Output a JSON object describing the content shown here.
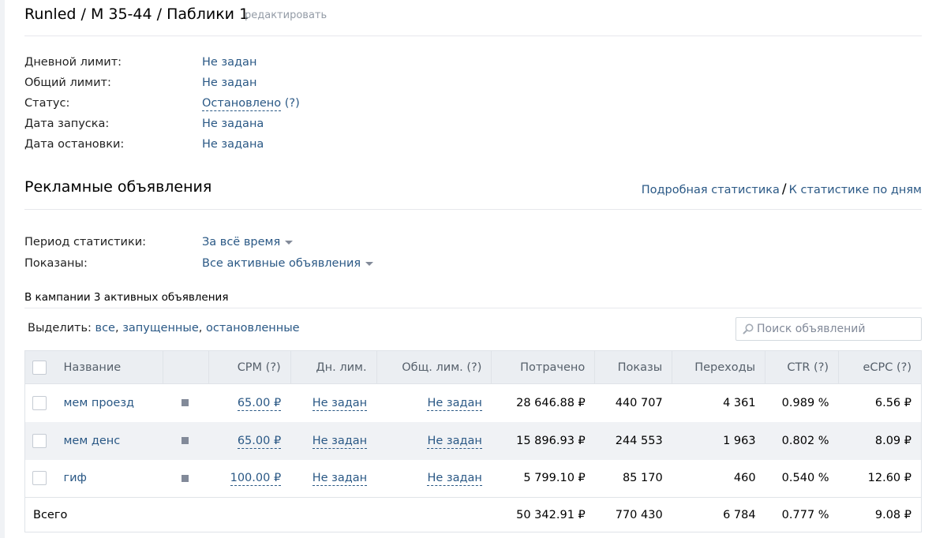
{
  "header": {
    "title": "Runled / М 35-44 / Паблики 1",
    "edit_link": "редактировать"
  },
  "campaign_info": [
    {
      "label": "Дневной лимит:",
      "value": "Не задан"
    },
    {
      "label": "Общий лимит:",
      "value": "Не задан"
    },
    {
      "label": "Статус:",
      "value": "Остановлено",
      "help": "(?)"
    },
    {
      "label": "Дата запуска:",
      "value": "Не задана"
    },
    {
      "label": "Дата остановки:",
      "value": "Не задана"
    }
  ],
  "ads_section": {
    "title": "Рекламные объявления",
    "detailed_stats_link": "Подробная статистика",
    "separator": "/",
    "daily_stats_link": "К статистике по дням"
  },
  "filters": {
    "period_label": "Период статистики:",
    "period_value": "За всё время",
    "shown_label": "Показаны:",
    "shown_value": "Все активные объявления"
  },
  "count_text": "В кампании 3 активных объявления",
  "select_bar": {
    "label": "Выделить:",
    "all": "все",
    "running": "запущенные",
    "stopped": "остановленные",
    "comma": ","
  },
  "search": {
    "placeholder": "Поиск объявлений"
  },
  "table": {
    "headers": {
      "name": "Название",
      "cpm": "CPM (?)",
      "daily_limit": "Дн. лим.",
      "total_limit": "Общ. лим. (?)",
      "spent": "Потрачено",
      "impressions": "Показы",
      "clicks": "Переходы",
      "ctr": "CTR (?)",
      "ecpc": "eCPC (?)"
    },
    "rows": [
      {
        "name": "мем проезд",
        "cpm": "65.00 ₽",
        "daily_limit": "Не задан",
        "total_limit": "Не задан",
        "spent": "28 646.88 ₽",
        "impressions": "440 707",
        "clicks": "4 361",
        "ctr": "0.989 %",
        "ecpc": "6.56 ₽"
      },
      {
        "name": "мем денс",
        "cpm": "65.00 ₽",
        "daily_limit": "Не задан",
        "total_limit": "Не задан",
        "spent": "15 896.93 ₽",
        "impressions": "244 553",
        "clicks": "1 963",
        "ctr": "0.802 %",
        "ecpc": "8.09 ₽"
      },
      {
        "name": "гиф",
        "cpm": "100.00 ₽",
        "daily_limit": "Не задан",
        "total_limit": "Не задан",
        "spent": "5 799.10 ₽",
        "impressions": "85 170",
        "clicks": "460",
        "ctr": "0.540 %",
        "ecpc": "12.60 ₽"
      }
    ],
    "total": {
      "label": "Всего",
      "spent": "50 342.91 ₽",
      "impressions": "770 430",
      "clicks": "6 784",
      "ctr": "0.777 %",
      "ecpc": "9.08 ₽"
    }
  },
  "icons": {
    "status_square": "status-square-icon",
    "search": "search-icon",
    "dropdown": "caret-down-icon"
  },
  "colors": {
    "link": "#2a5885",
    "muted": "#939ba6",
    "header_bg": "#ebeef2",
    "row_alt": "#f0f2f5"
  }
}
